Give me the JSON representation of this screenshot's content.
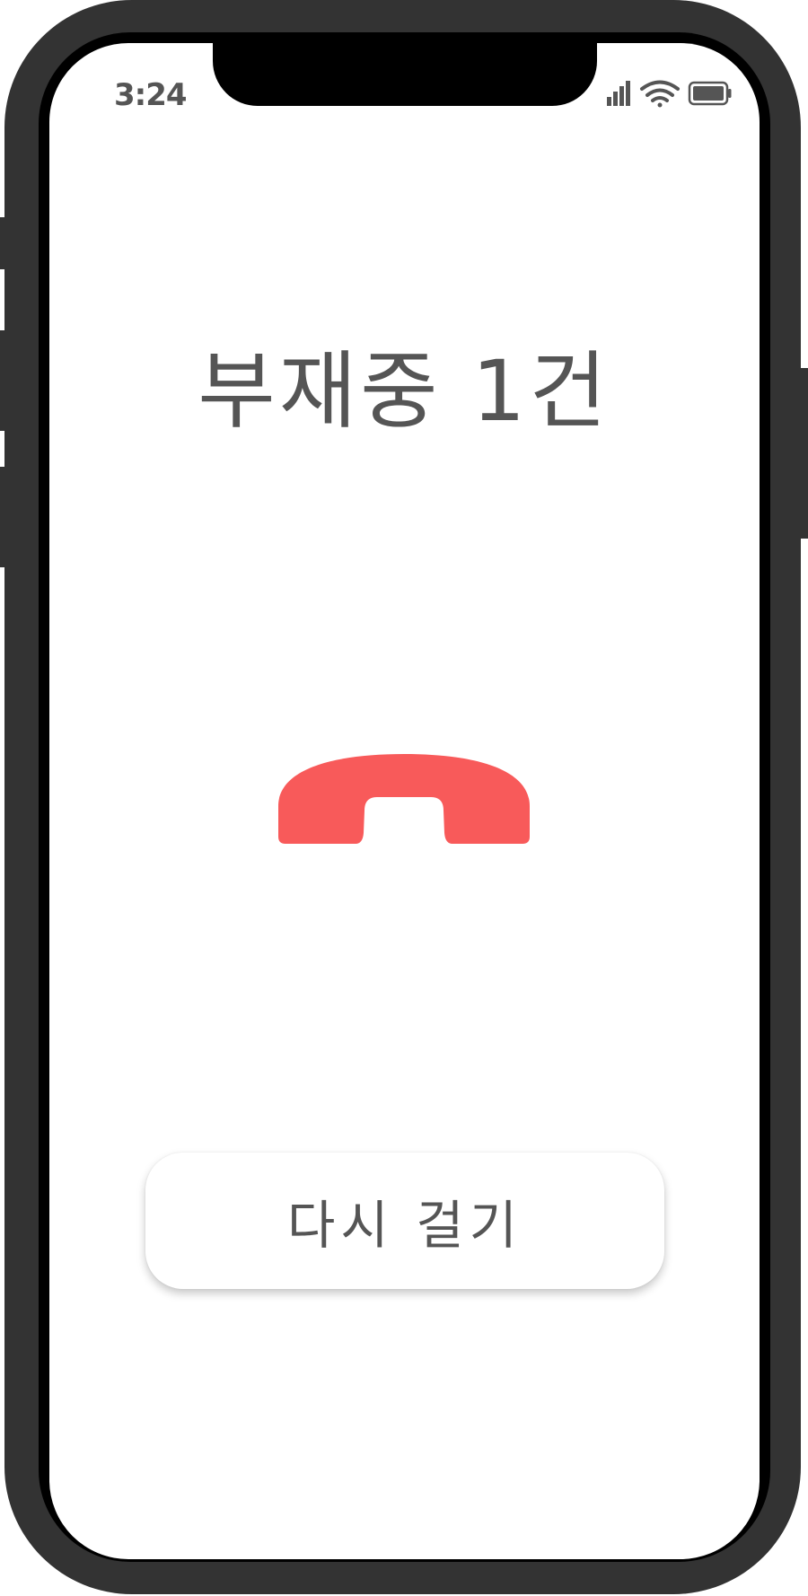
{
  "status_bar": {
    "time": "3:24",
    "icons": [
      "signal-icon",
      "wifi-icon",
      "battery-icon"
    ]
  },
  "main": {
    "title": "부재중 1건",
    "icon": "phone-hangup-icon",
    "redial_label": "다시 걸기"
  },
  "colors": {
    "frame": "#333333",
    "text": "#555555",
    "hangup_icon": "#F85A5A"
  }
}
